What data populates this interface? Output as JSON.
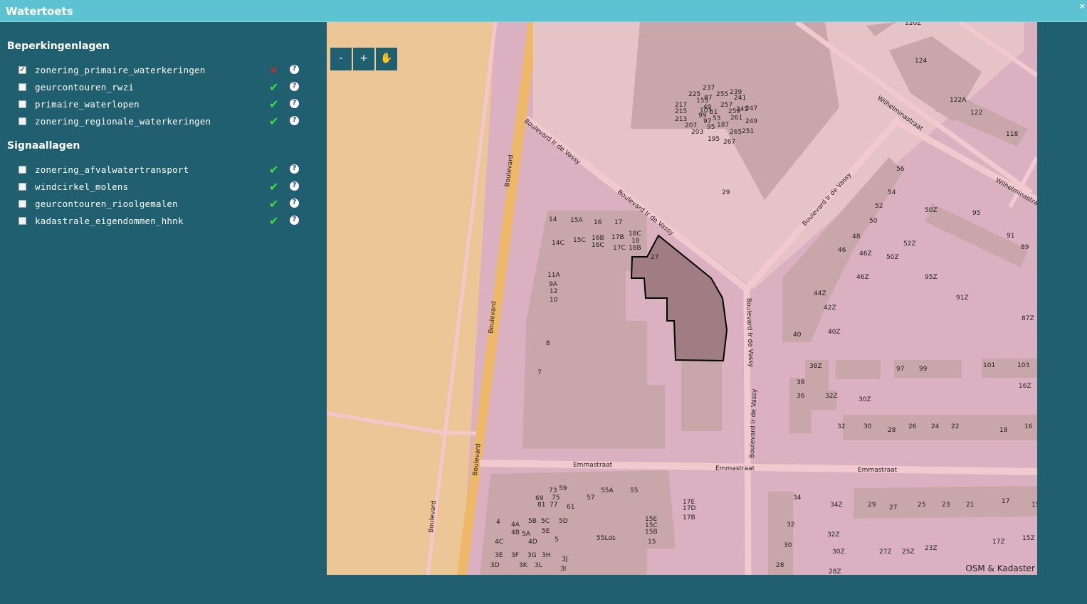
{
  "window": {
    "title": "Watertoets",
    "close_glyph": "×"
  },
  "sidebar": {
    "sections": [
      {
        "title": "Beperkingenlagen",
        "layers": [
          {
            "label": "zonering_primaire_waterkeringen",
            "checked": true,
            "status": "error",
            "status_icon": "red-cross-icon"
          },
          {
            "label": "geurcontouren_rwzi",
            "checked": false,
            "status": "ok",
            "status_icon": "green-check-icon"
          },
          {
            "label": "primaire_waterlopen",
            "checked": false,
            "status": "ok",
            "status_icon": "green-check-icon"
          },
          {
            "label": "zonering_regionale_waterkeringen",
            "checked": false,
            "status": "ok",
            "status_icon": "green-check-icon"
          }
        ]
      },
      {
        "title": "Signaallagen",
        "layers": [
          {
            "label": "zonering_afvalwatertransport",
            "checked": false,
            "status": "ok",
            "status_icon": "green-check-icon"
          },
          {
            "label": "windcirkel_molens",
            "checked": false,
            "status": "ok",
            "status_icon": "green-check-icon"
          },
          {
            "label": "geurcontouren_rioolgemalen",
            "checked": false,
            "status": "ok",
            "status_icon": "green-check-icon"
          },
          {
            "label": "kadastrale_eigendommen_hhnk",
            "checked": false,
            "status": "ok",
            "status_icon": "green-check-icon"
          }
        ]
      }
    ]
  },
  "map": {
    "controls": {
      "zoom_out": "-",
      "zoom_in": "+",
      "pan_icon": "hand-icon"
    },
    "attribution": "OSM & Kadaster",
    "streets": {
      "boulevard": "Boulevard",
      "boulevard_ir_de_vassy": "Boulevard Ir de Vassy",
      "emmastraat": "Emmastraat",
      "wilhelminastraat": "Wilhelminastraat"
    },
    "house_numbers": {
      "top": [
        "120Z",
        "124",
        "122A",
        "122",
        "118",
        "237",
        "225",
        "255",
        "239",
        "241",
        "217",
        "155",
        "87",
        "257",
        "245",
        "215",
        "101",
        "49",
        "51",
        "259",
        "247",
        "213",
        "99",
        "97",
        "53",
        "261",
        "249",
        "207",
        "95",
        "187",
        "265",
        "251",
        "203",
        "195",
        "267",
        "29"
      ],
      "middle": [
        "56",
        "54",
        "52",
        "50",
        "50Z",
        "95",
        "91",
        "89",
        "48",
        "46",
        "46Z",
        "52Z",
        "50Z",
        "46Z",
        "95Z",
        "44Z",
        "42Z",
        "91Z",
        "40",
        "40Z",
        "87Z",
        "14",
        "15A",
        "16",
        "17",
        "14C",
        "15C",
        "16B",
        "16C",
        "17B",
        "17C",
        "18C",
        "18",
        "18B",
        "27",
        "11A",
        "9A",
        "12",
        "10",
        "8",
        "7"
      ],
      "lower": [
        "38Z",
        "97",
        "99",
        "101",
        "103",
        "16Z",
        "38",
        "36",
        "32Z",
        "30Z",
        "32",
        "30",
        "28",
        "26",
        "24",
        "22",
        "18",
        "16"
      ],
      "bottom": [
        "73",
        "59",
        "55A",
        "55",
        "69",
        "75",
        "57",
        "17E",
        "17D",
        "81",
        "77",
        "61",
        "17B",
        "4",
        "4A",
        "5B",
        "5C",
        "5D",
        "4B",
        "5A",
        "5E",
        "15E",
        "15C",
        "15B",
        "4C",
        "4D",
        "5",
        "55Lds",
        "15",
        "3E",
        "3F",
        "3G",
        "3H",
        "3J",
        "3D",
        "3K",
        "3L",
        "3I",
        "34",
        "34Z",
        "29",
        "27",
        "25",
        "23",
        "21",
        "17",
        "15",
        "32",
        "32Z",
        "30",
        "30Z",
        "27Z",
        "25Z",
        "23Z",
        "17Z",
        "15Z",
        "28",
        "28Z"
      ]
    }
  }
}
